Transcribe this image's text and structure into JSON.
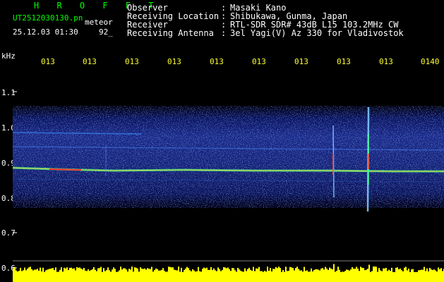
{
  "header": {
    "brand": "H R O F F T",
    "filename": "UT2512030130.pn",
    "mode": "meteor",
    "timestamp": "25.12.03 01:30",
    "count": "92_"
  },
  "station": {
    "rows": [
      {
        "label": "Observer",
        "sep": ":",
        "value": "Masaki Kano"
      },
      {
        "label": "Receiving Location",
        "sep": ":",
        "value": "Shibukawa, Gunma, Japan"
      },
      {
        "label": "Receiver",
        "sep": ":",
        "value": "RTL-SDR SDR# 43dB L15 103.2MHz CW"
      },
      {
        "label": "Receiving Antenna",
        "sep": ":",
        "value": "3el Yagi(V) Az 330 for Vladivostok"
      }
    ]
  },
  "axis": {
    "unit": "kHz",
    "y_ticks": [
      "1.1",
      "1.0",
      "0.9",
      "0.8",
      "0.7",
      "0.6"
    ],
    "x_ticks": [
      "013",
      "013",
      "013",
      "013",
      "013",
      "013",
      "013",
      "013",
      "013",
      "0140"
    ]
  },
  "colors": {
    "background": "#000000",
    "noise_floor": "#1a2a8a",
    "signal": "#ff3030",
    "header_green": "#00ff00",
    "header_yellow": "#ffff33",
    "power_bar": "#ffff00"
  }
}
